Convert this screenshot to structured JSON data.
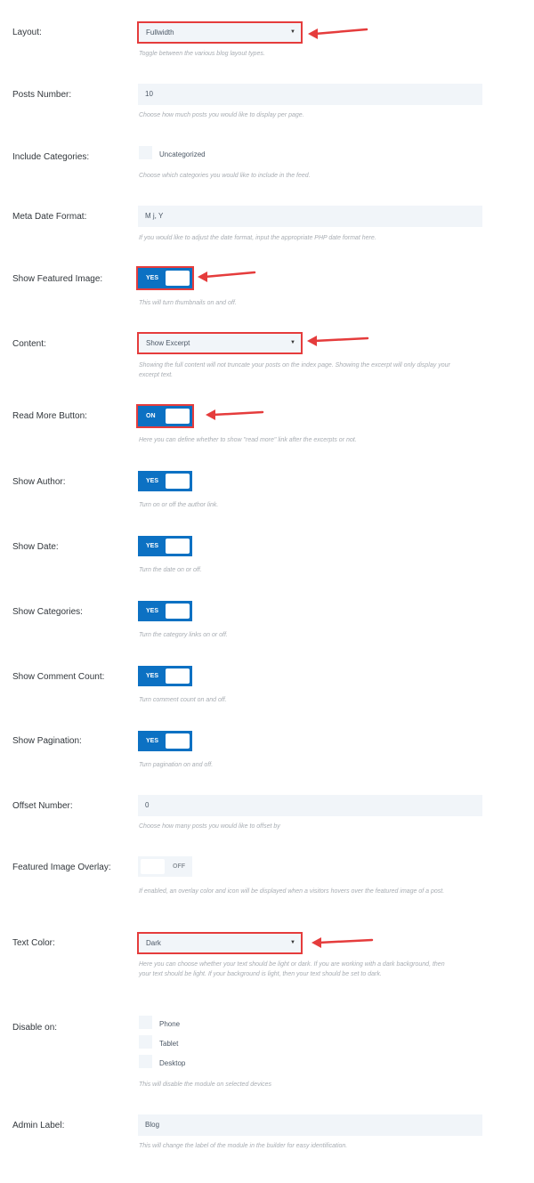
{
  "layout": {
    "label": "Layout:",
    "value": "Fullwidth",
    "desc": "Toggle between the various blog layout types."
  },
  "posts_number": {
    "label": "Posts Number:",
    "value": "10",
    "desc": "Choose how much posts you would like to display per page."
  },
  "include_categories": {
    "label": "Include Categories:",
    "option": "Uncategorized",
    "desc": "Choose which categories you would like to include in the feed."
  },
  "meta_date_format": {
    "label": "Meta Date Format:",
    "value": "M j, Y",
    "desc": "If you would like to adjust the date format, input the appropriate PHP date format here."
  },
  "show_featured_image": {
    "label": "Show Featured Image:",
    "state": "YES",
    "desc": "This will turn thumbnails on and off."
  },
  "content": {
    "label": "Content:",
    "value": "Show Excerpt",
    "desc": "Showing the full content will not truncate your posts on the index page. Showing the excerpt will only display your excerpt text."
  },
  "read_more_button": {
    "label": "Read More Button:",
    "state": "ON",
    "desc": "Here you can define whether to show \"read more\" link after the excerpts or not."
  },
  "show_author": {
    "label": "Show Author:",
    "state": "YES",
    "desc": "Turn on or off the author link."
  },
  "show_date": {
    "label": "Show Date:",
    "state": "YES",
    "desc": "Turn the date on or off."
  },
  "show_categories": {
    "label": "Show Categories:",
    "state": "YES",
    "desc": "Turn the category links on or off."
  },
  "show_comment_count": {
    "label": "Show Comment Count:",
    "state": "YES",
    "desc": "Turn comment count on and off."
  },
  "show_pagination": {
    "label": "Show Pagination:",
    "state": "YES",
    "desc": "Turn pagination on and off."
  },
  "offset_number": {
    "label": "Offset Number:",
    "value": "0",
    "desc": "Choose how many posts you would like to offset by"
  },
  "featured_image_overlay": {
    "label": "Featured Image Overlay:",
    "state": "OFF",
    "desc": "If enabled, an overlay color and icon will be displayed when a visitors hovers over the featured image of a post."
  },
  "text_color": {
    "label": "Text Color:",
    "value": "Dark",
    "desc": "Here you can choose whether your text should be light or dark. If you are working with a dark background, then your text should be light. If your background is light, then your text should be set to dark."
  },
  "disable_on": {
    "label": "Disable on:",
    "options": [
      "Phone",
      "Tablet",
      "Desktop"
    ],
    "desc": "This will disable the module on selected devices"
  },
  "admin_label": {
    "label": "Admin Label:",
    "value": "Blog",
    "desc": "This will change the label of the module in the builder for easy identification."
  },
  "colors": {
    "accent": "#0c71c3",
    "highlight": "#e53c3c",
    "field_bg": "#f1f5f9"
  }
}
